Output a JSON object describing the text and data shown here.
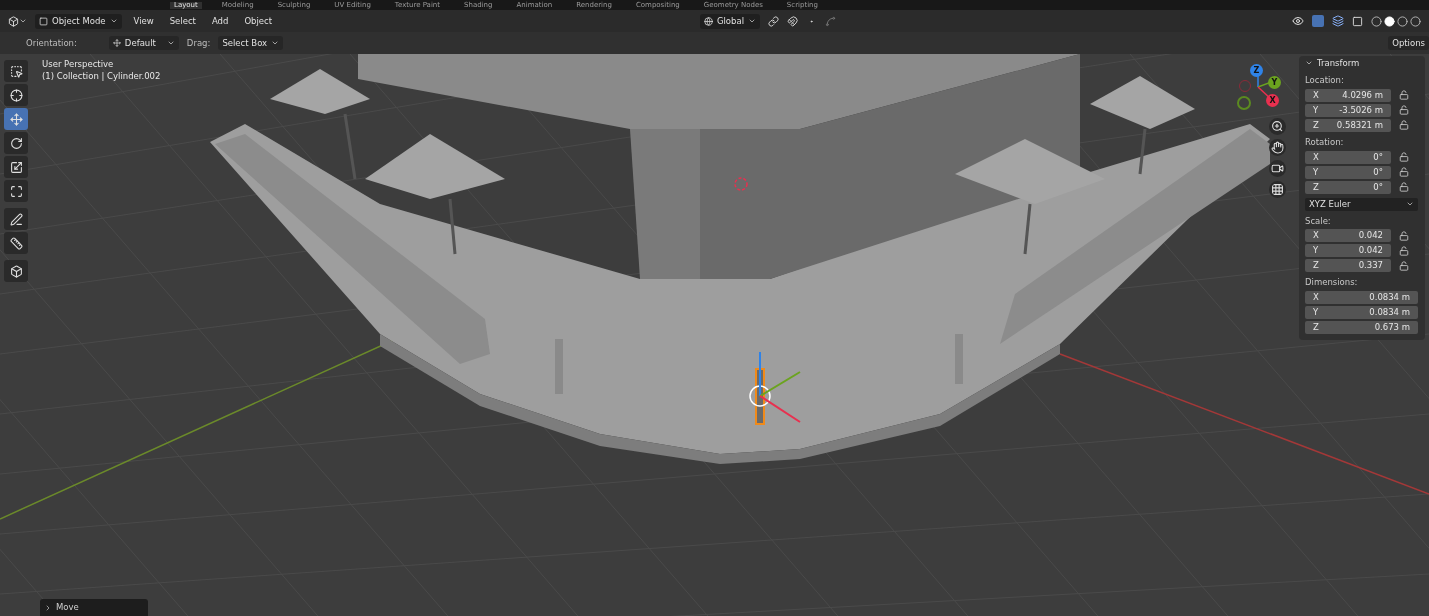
{
  "workspace_tabs": [
    {
      "label": "Layout",
      "selected": true
    },
    {
      "label": "Modeling",
      "selected": false
    },
    {
      "label": "Sculpting",
      "selected": false
    },
    {
      "label": "UV Editing",
      "selected": false
    },
    {
      "label": "Texture Paint",
      "selected": false
    },
    {
      "label": "Shading",
      "selected": false
    },
    {
      "label": "Animation",
      "selected": false
    },
    {
      "label": "Rendering",
      "selected": false
    },
    {
      "label": "Compositing",
      "selected": false
    },
    {
      "label": "Geometry Nodes",
      "selected": false
    },
    {
      "label": "Scripting",
      "selected": false
    }
  ],
  "header": {
    "mode": "Object Mode",
    "menus": [
      "View",
      "Select",
      "Add",
      "Object"
    ],
    "transform_orientation": "Global",
    "shading_modes": [
      {
        "selected": false
      },
      {
        "selected": true
      },
      {
        "selected": false
      },
      {
        "selected": false
      }
    ]
  },
  "tool_settings": {
    "orientation_label": "Orientation:",
    "orientation": "Default",
    "drag_label": "Drag:",
    "drag": "Select Box",
    "options": "Options"
  },
  "viewport": {
    "view_name": "User Perspective",
    "object_info": "(1) Collection | Cylinder.002",
    "tools": [
      {
        "kind": "select",
        "selected": false
      },
      {
        "kind": "cursor",
        "selected": false
      },
      {
        "kind": "move",
        "selected": true
      },
      {
        "kind": "rotate",
        "selected": false
      },
      {
        "kind": "scale",
        "selected": false
      },
      {
        "kind": "transform",
        "selected": false
      },
      {
        "kind": "annotate",
        "selected": false
      },
      {
        "kind": "measure",
        "selected": false
      },
      {
        "kind": "add_cube",
        "selected": false
      }
    ],
    "gizmo_axes": [
      {
        "label": "Z",
        "color": "#2f83e8"
      },
      {
        "label": "Y",
        "color": "#6ba31f"
      },
      {
        "label": "X",
        "color": "#e8304f"
      }
    ],
    "last_operator": "Move"
  },
  "sidebar": {
    "panel_title": "Transform",
    "location": {
      "label": "Location:",
      "rows": [
        {
          "axis": "X",
          "value": "4.0296 m",
          "locked": false
        },
        {
          "axis": "Y",
          "value": "-3.5026 m",
          "locked": false
        },
        {
          "axis": "Z",
          "value": "0.58321 m",
          "locked": false
        }
      ]
    },
    "rotation": {
      "label": "Rotation:",
      "rows": [
        {
          "axis": "X",
          "value": "0°",
          "locked": false
        },
        {
          "axis": "Y",
          "value": "0°",
          "locked": false
        },
        {
          "axis": "Z",
          "value": "0°",
          "locked": false
        }
      ]
    },
    "rotation_mode": "XYZ Euler",
    "scale": {
      "label": "Scale:",
      "rows": [
        {
          "axis": "X",
          "value": "0.042",
          "locked": false
        },
        {
          "axis": "Y",
          "value": "0.042",
          "locked": false
        },
        {
          "axis": "Z",
          "value": "0.337",
          "locked": false
        }
      ]
    },
    "dimensions": {
      "label": "Dimensions:",
      "rows": [
        {
          "axis": "X",
          "value": "0.0834 m"
        },
        {
          "axis": "Y",
          "value": "0.0834 m"
        },
        {
          "axis": "Z",
          "value": "0.673 m"
        }
      ]
    }
  }
}
